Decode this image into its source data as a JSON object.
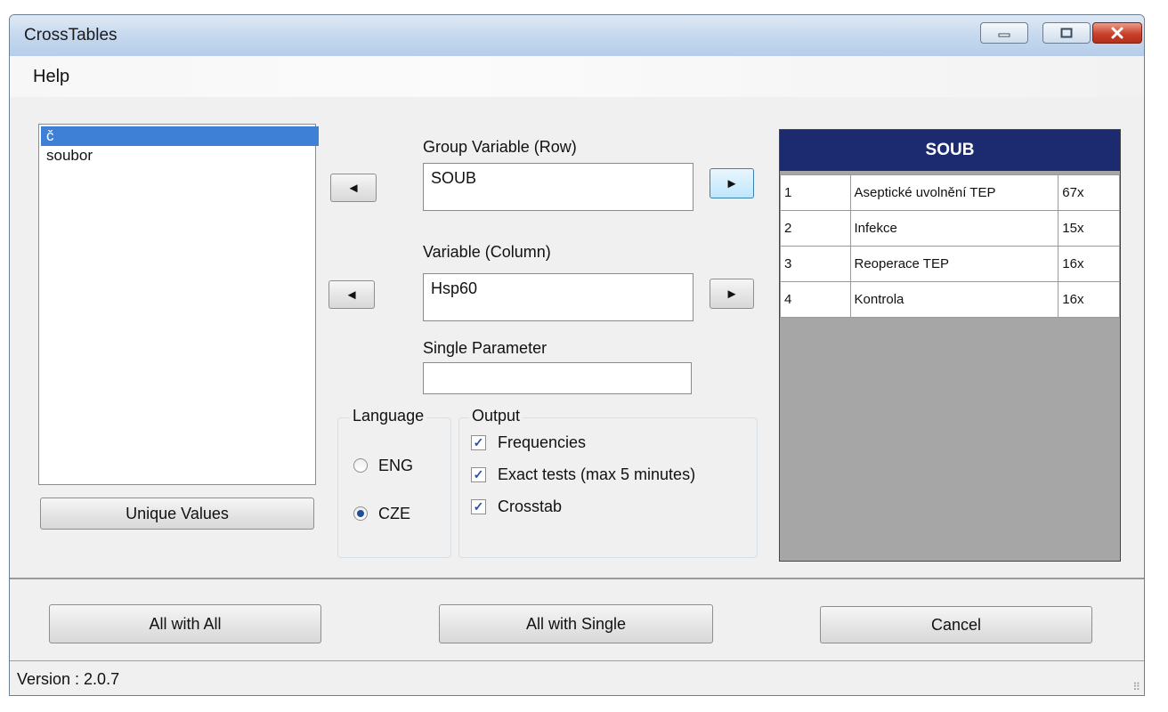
{
  "window": {
    "title": "CrossTables"
  },
  "menu": {
    "help": "Help"
  },
  "variables_list": [
    {
      "label": "č",
      "selected": true
    },
    {
      "label": "soubor",
      "selected": false
    }
  ],
  "unique_values_button": "Unique Values",
  "group_variable": {
    "label": "Group Variable (Row)",
    "value": "SOUB"
  },
  "column_variable": {
    "label": "Variable (Column)",
    "value": "Hsp60"
  },
  "single_parameter": {
    "label": "Single Parameter",
    "value": ""
  },
  "arrows": {
    "left": "◄",
    "right": "►"
  },
  "language": {
    "title": "Language",
    "options": [
      {
        "label": "ENG",
        "checked": false
      },
      {
        "label": "CZE",
        "checked": true
      }
    ]
  },
  "output": {
    "title": "Output",
    "options": [
      {
        "label": "Frequencies",
        "checked": true
      },
      {
        "label": "Exact tests (max 5 minutes)",
        "checked": true
      },
      {
        "label": "Crosstab",
        "checked": true
      }
    ]
  },
  "values_panel": {
    "header": "SOUB",
    "rows": [
      {
        "code": "1",
        "name": "Aseptické uvolnění TEP",
        "count": "67x"
      },
      {
        "code": "2",
        "name": "Infekce",
        "count": "15x"
      },
      {
        "code": "3",
        "name": "Reoperace TEP",
        "count": "16x"
      },
      {
        "code": "4",
        "name": "Kontrola",
        "count": "16x"
      }
    ]
  },
  "bottom_buttons": {
    "all_with_all": "All with All",
    "all_with_single": "All with Single",
    "cancel": "Cancel"
  },
  "status": {
    "version": "Version : 2.0.7"
  },
  "colors": {
    "selection": "#3d80d6",
    "panel_header": "#1c2b6f",
    "panel_bg": "#a6a6a6",
    "check": "#2d4fa6"
  },
  "icons": {
    "minimize": "minimize-icon",
    "maximize": "maximize-icon",
    "close": "close-icon"
  }
}
